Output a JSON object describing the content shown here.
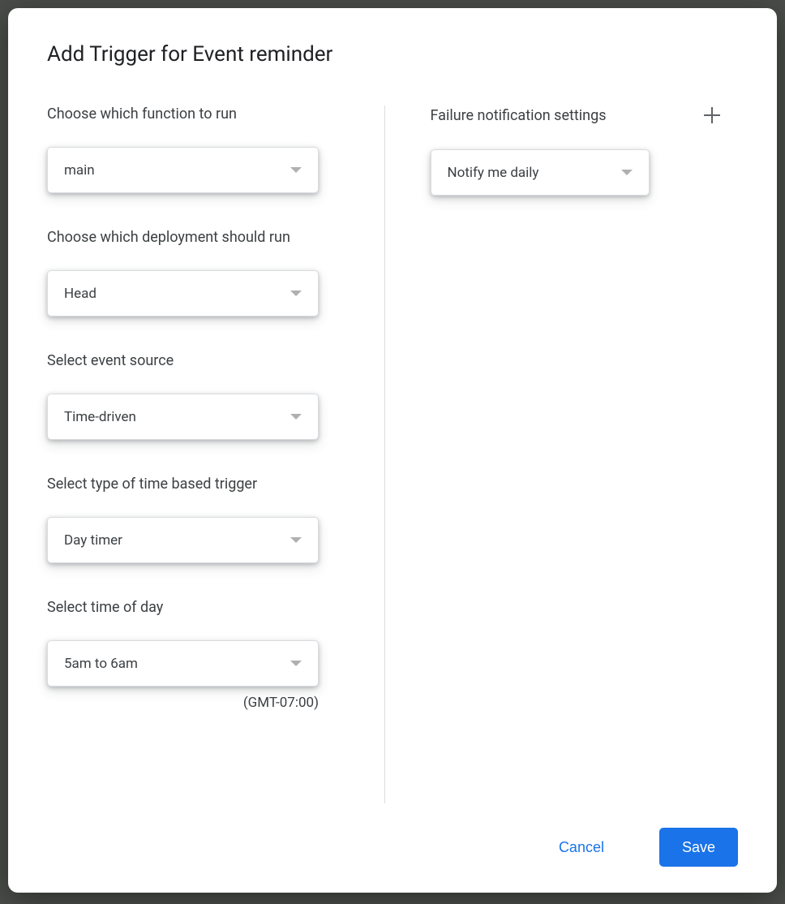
{
  "dialog": {
    "title": "Add Trigger for Event reminder"
  },
  "left": {
    "function": {
      "label": "Choose which function to run",
      "value": "main"
    },
    "deployment": {
      "label": "Choose which deployment should run",
      "value": "Head"
    },
    "event_source": {
      "label": "Select event source",
      "value": "Time-driven"
    },
    "trigger_type": {
      "label": "Select type of time based trigger",
      "value": "Day timer"
    },
    "time_of_day": {
      "label": "Select time of day",
      "value": "5am to 6am",
      "tz": "(GMT-07:00)"
    }
  },
  "right": {
    "failure": {
      "label": "Failure notification settings",
      "value": "Notify me daily"
    }
  },
  "actions": {
    "cancel": "Cancel",
    "save": "Save"
  }
}
